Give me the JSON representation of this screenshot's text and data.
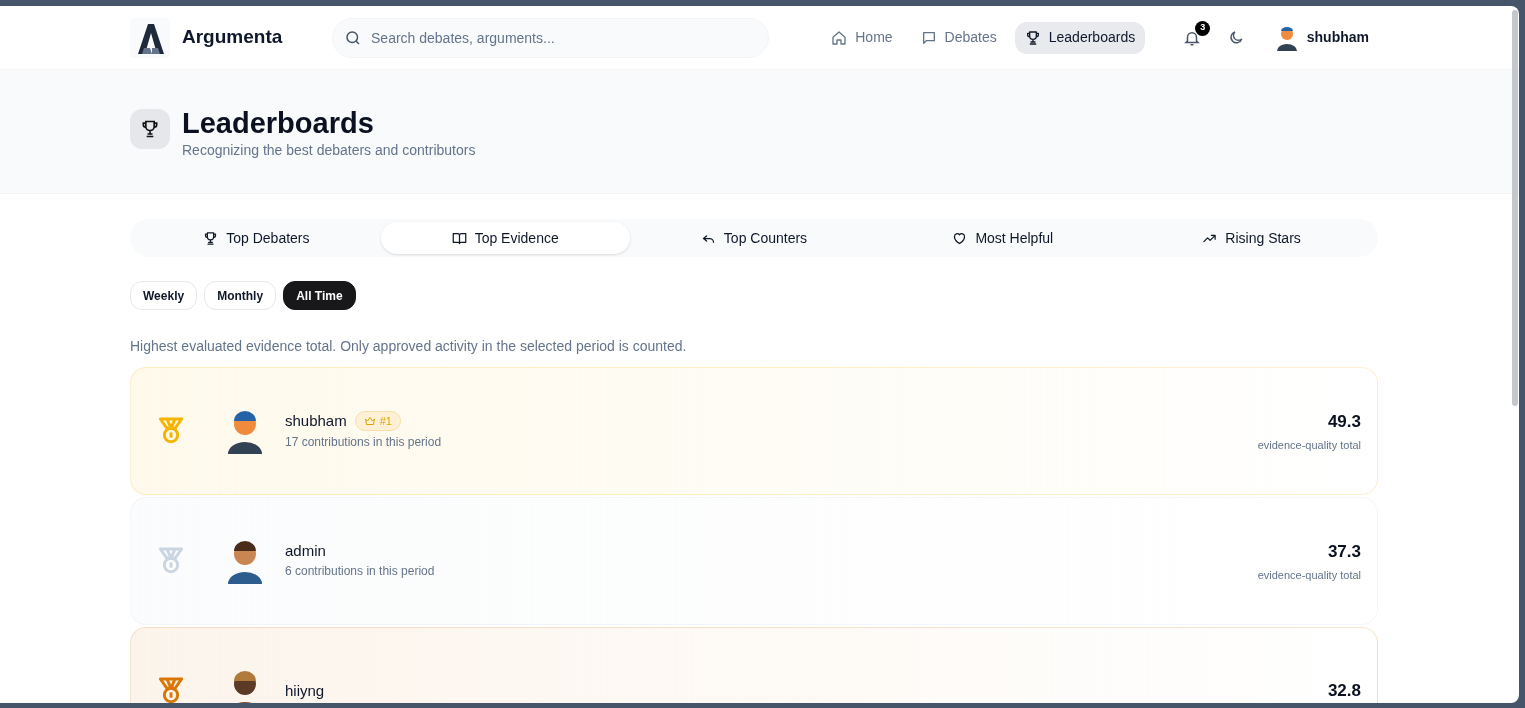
{
  "brand": {
    "name": "Argumenta"
  },
  "search": {
    "placeholder": "Search debates, arguments..."
  },
  "nav": [
    {
      "label": "Home",
      "selected": false
    },
    {
      "label": "Debates",
      "selected": false
    },
    {
      "label": "Leaderboards",
      "selected": true
    }
  ],
  "notifications": {
    "count": "3"
  },
  "user": {
    "name": "shubham"
  },
  "page": {
    "title": "Leaderboards",
    "subtitle": "Recognizing the best debaters and contributors"
  },
  "tabs": [
    {
      "label": "Top Debaters",
      "selected": false
    },
    {
      "label": "Top Evidence",
      "selected": true
    },
    {
      "label": "Top Counters",
      "selected": false
    },
    {
      "label": "Most Helpful",
      "selected": false
    },
    {
      "label": "Rising Stars",
      "selected": false
    }
  ],
  "periods": [
    {
      "label": "Weekly",
      "selected": false
    },
    {
      "label": "Monthly",
      "selected": false
    },
    {
      "label": "All Time",
      "selected": true
    }
  ],
  "description": "Highest evaluated evidence total. Only approved activity in the selected period is counted.",
  "entries": [
    {
      "color": "#f5b400",
      "name": "shubham",
      "badge": "#1",
      "detail": "17 contributions in this period",
      "score": "49.3",
      "score_label": "evidence-quality total"
    },
    {
      "color": "#cbd5e1",
      "name": "admin",
      "detail": "6 contributions in this period",
      "score": "37.3",
      "score_label": "evidence-quality total"
    },
    {
      "color": "#d97706",
      "name": "hiiyng",
      "score": "32.8"
    }
  ]
}
